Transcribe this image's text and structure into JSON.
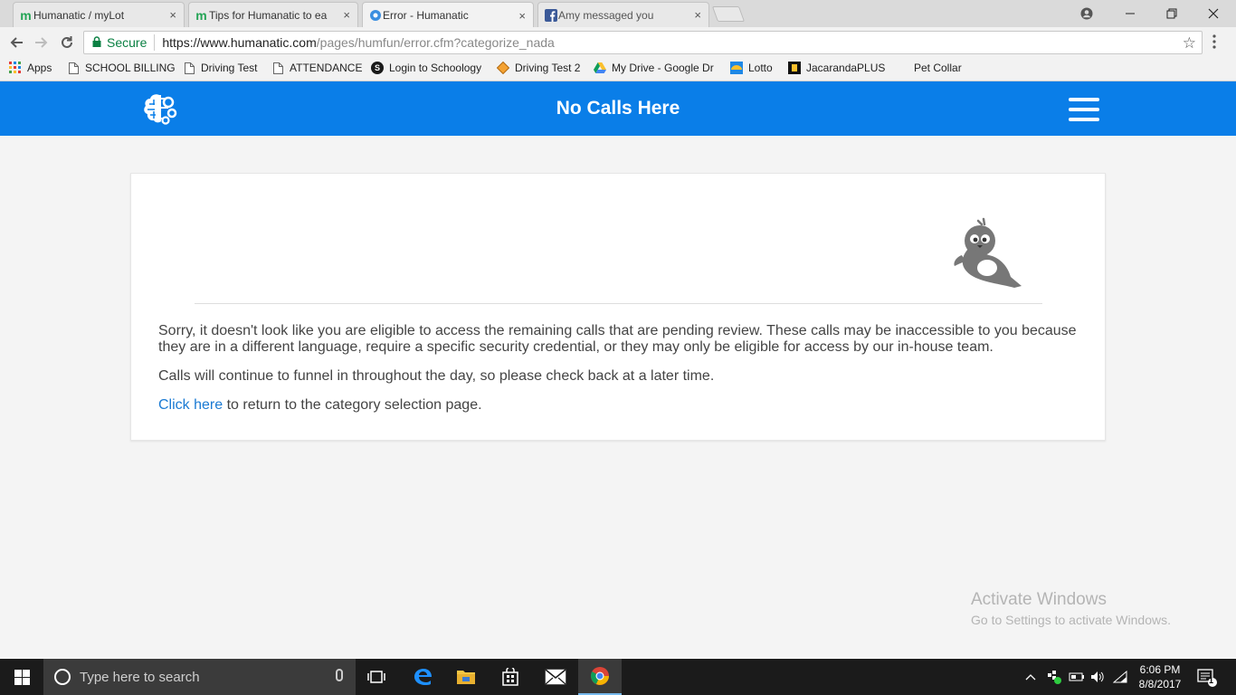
{
  "browser": {
    "tabs": [
      {
        "title": "Humanatic / myLot",
        "favicon": "mylot-m-icon",
        "active": false
      },
      {
        "title": "Tips for Humanatic to ea",
        "favicon": "mylot-m-icon",
        "active": false
      },
      {
        "title": "Error - Humanatic",
        "favicon": "humanatic-brain-icon",
        "active": true
      },
      {
        "title": "Amy messaged you",
        "favicon": "facebook-icon",
        "active": false
      }
    ],
    "close_glyph": "×",
    "secure_label": "Secure",
    "url_host": "https://www.humanatic.com",
    "url_path": "/pages/humfun/error.cfm?categorize_nada"
  },
  "bookmarks": [
    {
      "label": "Apps",
      "icon": "apps-grid-icon"
    },
    {
      "label": "SCHOOL BILLING",
      "icon": "page-icon"
    },
    {
      "label": "Driving Test",
      "icon": "page-icon"
    },
    {
      "label": "ATTENDANCE",
      "icon": "page-icon"
    },
    {
      "label": "Login to Schoology",
      "icon": "schoology-icon"
    },
    {
      "label": "Driving Test 2",
      "icon": "diamond-icon"
    },
    {
      "label": "My Drive - Google Dr",
      "icon": "google-drive-icon"
    },
    {
      "label": "Lotto",
      "icon": "lotto-icon"
    },
    {
      "label": "JacarandaPLUS",
      "icon": "jacaranda-icon"
    },
    {
      "label": "Pet Collar",
      "icon": ""
    }
  ],
  "header": {
    "title": "No Calls Here"
  },
  "card": {
    "paragraph1": "Sorry, it doesn't look like you are eligible to access the remaining calls that are pending review. These calls may be inaccessible to you because they are in a different language, require a specific security credential, or they may only be eligible for access by our in-house team.",
    "paragraph2": "Calls will continue to funnel in throughout the day, so please check back at a later time.",
    "link_text": "Click here",
    "paragraph3_rest": " to return to the category selection page."
  },
  "watermark": {
    "line1": "Activate Windows",
    "line2": "Go to Settings to activate Windows."
  },
  "taskbar": {
    "search_placeholder": "Type here to search",
    "time": "6:06 PM",
    "date": "8/8/2017",
    "notification_count": "1"
  },
  "colors": {
    "header_blue": "#0a7ee8",
    "link_blue": "#1a7ad3",
    "secure_green": "#0b8043"
  }
}
